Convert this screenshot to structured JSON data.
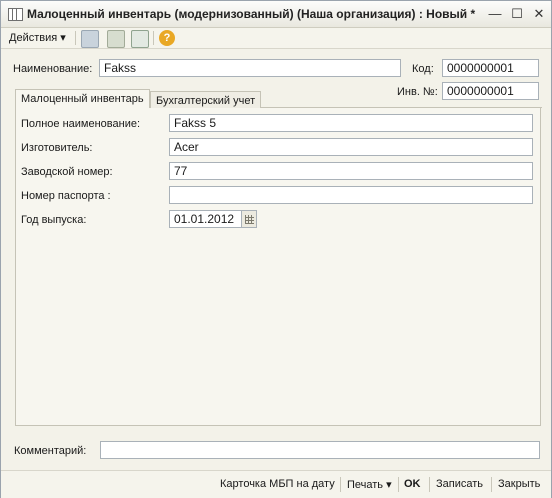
{
  "window": {
    "title": "Малоценный инвентарь (модернизованный) (Наша организация) : Новый *",
    "minimize": "—",
    "maximize": "☐",
    "close": "✕"
  },
  "toolbar": {
    "actions_label": "Действия",
    "actions_arrow": "▾",
    "help_glyph": "?",
    "icons": [
      "back-icon",
      "structure-icon",
      "new-from-template-icon",
      "help-icon"
    ]
  },
  "form": {
    "name_label": "Наименование:",
    "name_value": "Fakss",
    "code_label": "Код:",
    "code_value": "0000000001",
    "inv_label": "Инв. №:",
    "inv_value": "0000000001"
  },
  "tabs": [
    {
      "label": "Малоценный инвентарь"
    },
    {
      "label": "Бухгалтерский учет"
    }
  ],
  "details": {
    "full_name_label": "Полное наименование:",
    "full_name_value": "Fakss 5",
    "manufacturer_label": "Изготовитель:",
    "manufacturer_value": "Acer",
    "serial_label": "Заводской номер:",
    "serial_value": "77",
    "passport_label": "Номер паспорта :",
    "passport_value": "",
    "year_label": "Год выпуска:",
    "year_value": "01.01.2012"
  },
  "comment": {
    "label": "Комментарий:",
    "value": ""
  },
  "bottom": {
    "card_label": "Карточка МБП на дату",
    "print_label": "Печать",
    "print_arrow": "▾",
    "ok_label": "OK",
    "save_label": "Записать",
    "close_label": "Закрыть"
  },
  "colors": {
    "window_bg": "#f3f2e9",
    "help_icon": "#e9a825"
  }
}
